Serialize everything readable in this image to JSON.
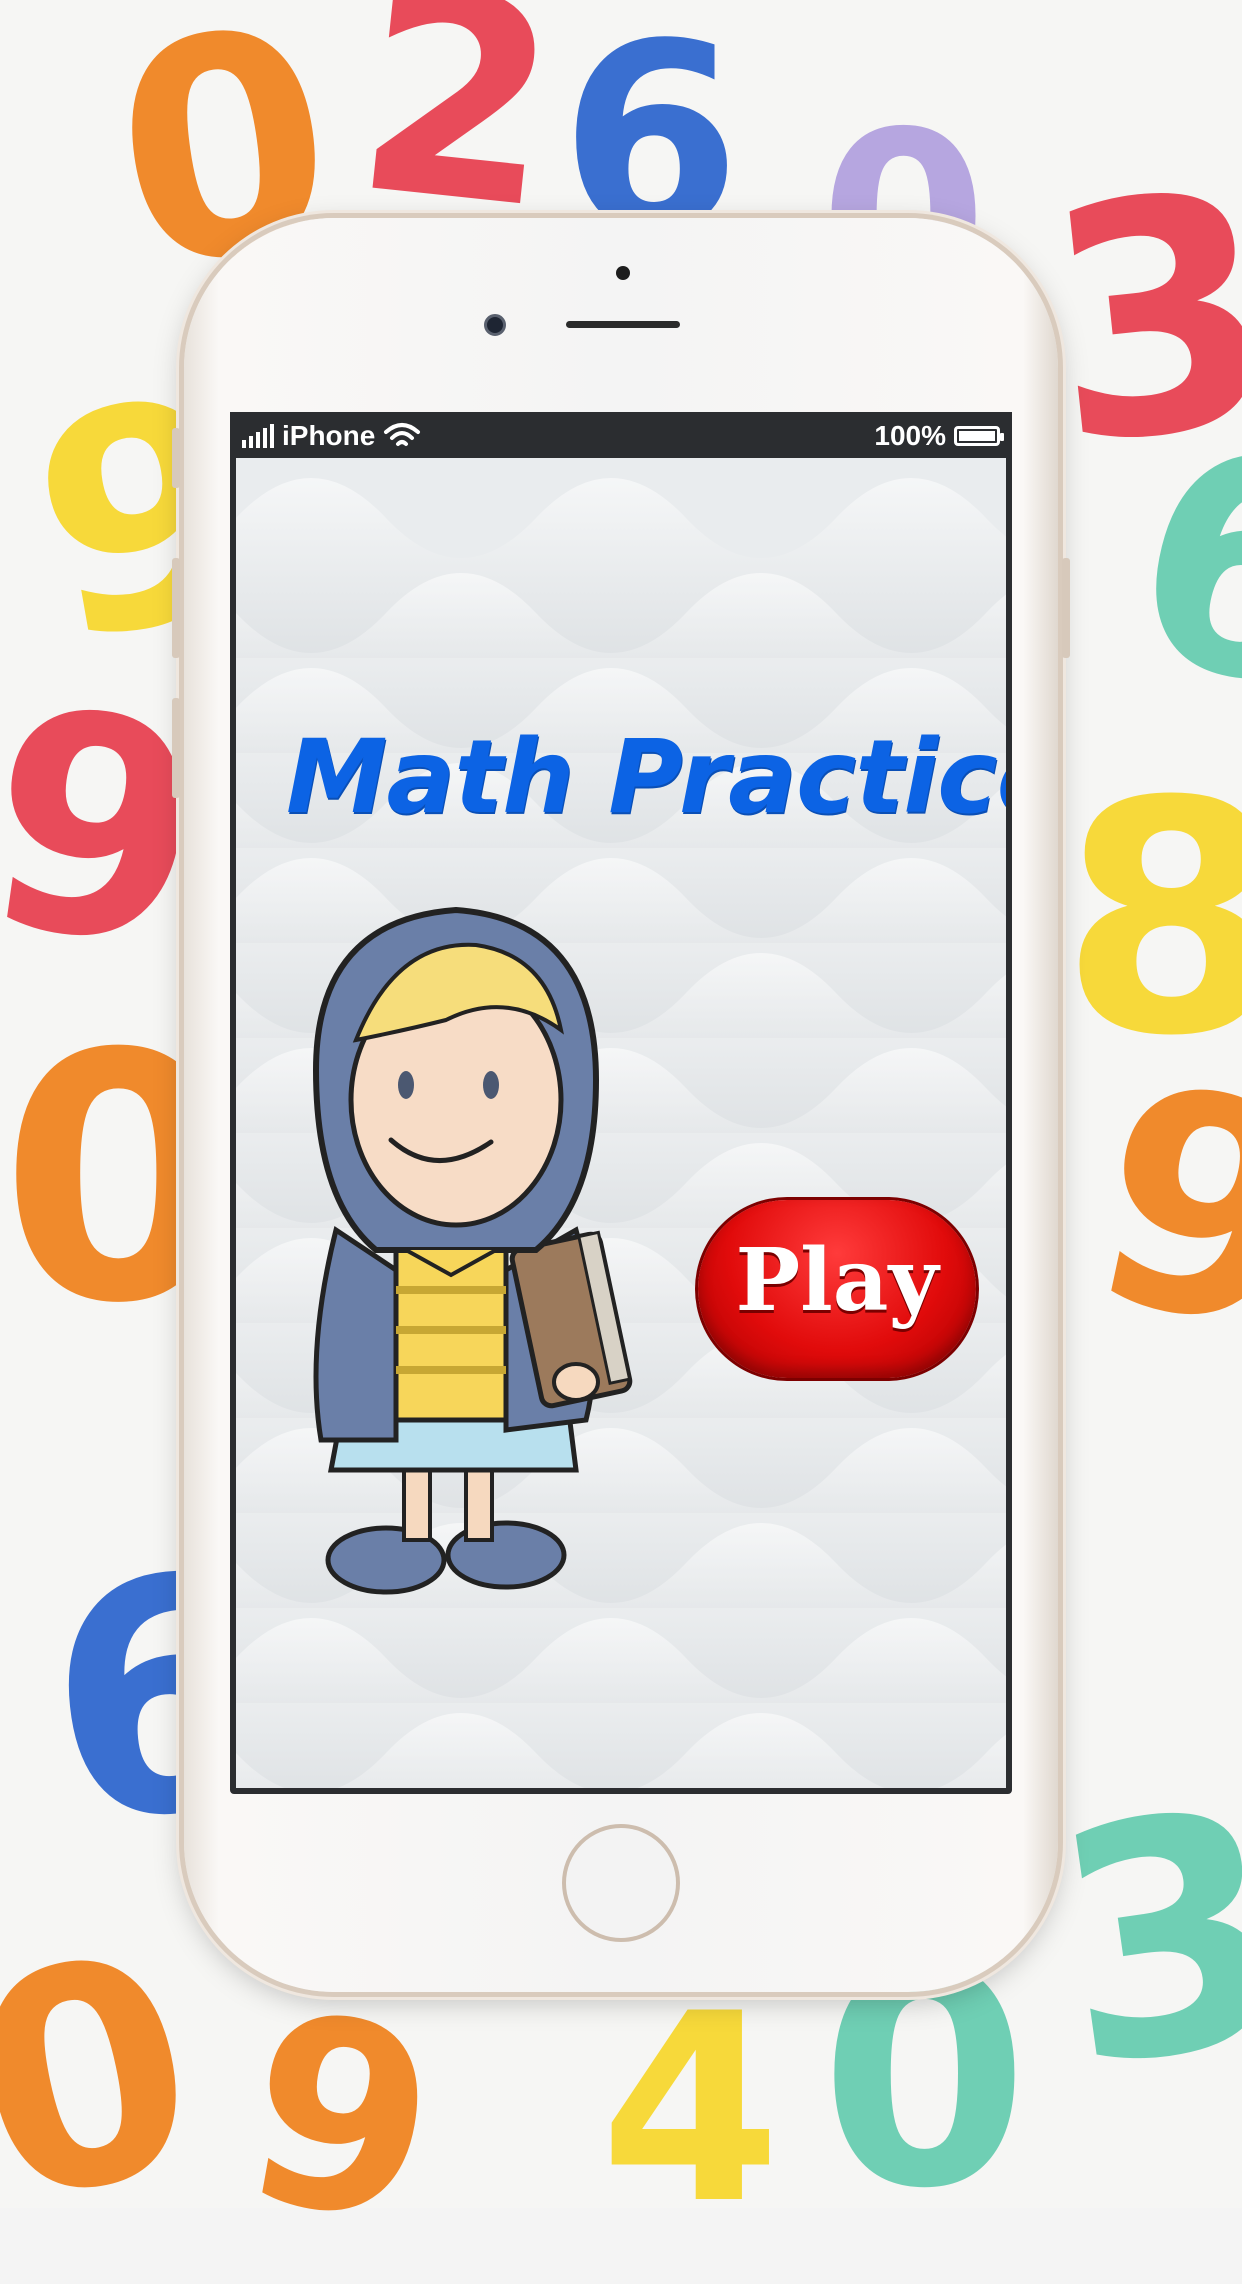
{
  "status_bar": {
    "carrier": "iPhone",
    "battery_percent": "100%",
    "signal_icon": "signal-bars-icon",
    "wifi_icon": "wifi-icon",
    "battery_icon": "battery-icon"
  },
  "app": {
    "title": "Math Practice",
    "play_label": "Play",
    "illustration": "cartoon-girl-with-book"
  },
  "colors": {
    "title": "#0c63e4",
    "play_button": "#e10b0b",
    "phone_frame": "#f4f4f4",
    "phone_bezel_accent": "#d9cbbd"
  },
  "background_digits": [
    {
      "char": "0",
      "color": "#f08a2c"
    },
    {
      "char": "2",
      "color": "#e84b5a"
    },
    {
      "char": "6",
      "color": "#3a6fd0"
    },
    {
      "char": "3",
      "color": "#e84b5a"
    },
    {
      "char": "9",
      "color": "#f7d93a"
    },
    {
      "char": "9",
      "color": "#e84b5a"
    },
    {
      "char": "0",
      "color": "#f08a2c"
    },
    {
      "char": "8",
      "color": "#f7d93a"
    },
    {
      "char": "9",
      "color": "#f08a2c"
    },
    {
      "char": "6",
      "color": "#3a6fd0"
    },
    {
      "char": "0",
      "color": "#f08a2c"
    },
    {
      "char": "9",
      "color": "#f08a2c"
    },
    {
      "char": "4",
      "color": "#f7d93a"
    },
    {
      "char": "0",
      "color": "#6fcfb4"
    },
    {
      "char": "3",
      "color": "#6fcfb4"
    },
    {
      "char": "6",
      "color": "#6fcfb4"
    },
    {
      "char": "0",
      "color": "#b6a6e0"
    }
  ]
}
